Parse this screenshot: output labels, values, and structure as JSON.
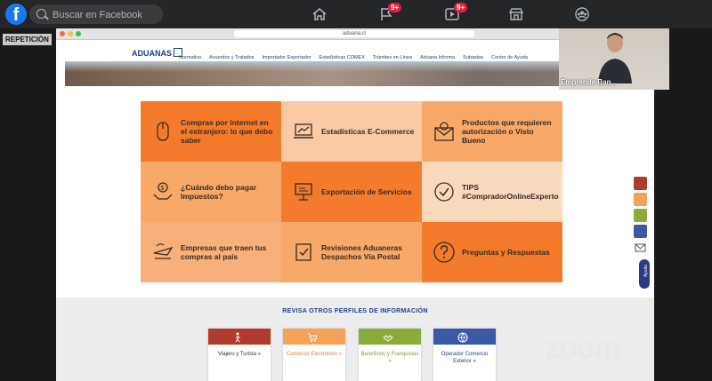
{
  "facebook": {
    "logo_letter": "f",
    "search_placeholder": "Buscar en Facebook",
    "nav": [
      {
        "icon": "home-icon",
        "badge": ""
      },
      {
        "icon": "flag-icon",
        "badge": "9+"
      },
      {
        "icon": "video-icon",
        "badge": "9+"
      },
      {
        "icon": "marketplace-icon",
        "badge": ""
      },
      {
        "icon": "groups-icon",
        "badge": ""
      }
    ]
  },
  "replay_label": "REPETICIÓN",
  "browser": {
    "url": "aduana.cl",
    "site": {
      "logo_text": "ADUANAS",
      "menu": [
        "Normativa",
        "Acuerdos y Tratados",
        "Importador Exportador",
        "Estadísticas COMEX",
        "Trámites en Línea",
        "Aduana Informa",
        "Subastas",
        "Centro de Ayuda"
      ]
    },
    "tiles": [
      {
        "label": "Compras por internet en el extranjero: lo que debo saber",
        "icon": "mouse-icon",
        "color": "#f47b2b"
      },
      {
        "label": "Estadísticas E-Commerce",
        "icon": "laptop-chart-icon",
        "color": "#fbc9a3"
      },
      {
        "label": "Productos que requieren autorización o Visto Bueno",
        "icon": "envelope-approved-icon",
        "color": "#f8a868"
      },
      {
        "label": "¿Cuándo debo pagar Impuestos?",
        "icon": "money-hands-icon",
        "color": "#f8a868"
      },
      {
        "label": "Exportación de Servicios",
        "icon": "presentation-icon",
        "color": "#f47b2b"
      },
      {
        "label": "TIPS #CompradorOnlineExperto",
        "icon": "check-circle-icon",
        "color": "#fbd9bd"
      },
      {
        "label": "Empresas que traen tus compras al país",
        "icon": "delivery-plane-icon",
        "color": "#f8b07a"
      },
      {
        "label": "Revisiones Aduaneras Despachos Vía Postal",
        "icon": "postal-check-icon",
        "color": "#f8a868"
      },
      {
        "label": "Preguntas y Respuestas",
        "icon": "question-icon",
        "color": "#f47b2b"
      }
    ],
    "profiles_title": "REVISA OTROS PERFILES DE INFORMACIÓN",
    "profiles": [
      {
        "label": "Viajero y Turista »",
        "color": "#b03a2e",
        "text_color": "#333333",
        "icon": "traveler-icon"
      },
      {
        "label": "Comercio Electrónico »",
        "color": "#f4a259",
        "text_color": "#e07b2a",
        "icon": "cart-icon"
      },
      {
        "label": "Beneficios y Franquicias »",
        "color": "#8bab3c",
        "text_color": "#7a9a2c",
        "icon": "handshake-icon"
      },
      {
        "label": "Operador Comercio Exterior »",
        "color": "#3a5aa8",
        "text_color": "#1d3f87",
        "icon": "globe-icon"
      }
    ],
    "side_tools": [
      {
        "icon": "traveler-icon",
        "color": "#b03a2e"
      },
      {
        "icon": "cart-icon",
        "color": "#f4a259"
      },
      {
        "icon": "handshake-icon",
        "color": "#8bab3c"
      },
      {
        "icon": "globe-icon",
        "color": "#3a5aa8"
      },
      {
        "icon": "mail-icon",
        "color": "#ffffff"
      }
    ],
    "help_label": "Ayuda"
  },
  "video": {
    "participant_name": "Emprende Ban..."
  },
  "watermark": "zoom"
}
